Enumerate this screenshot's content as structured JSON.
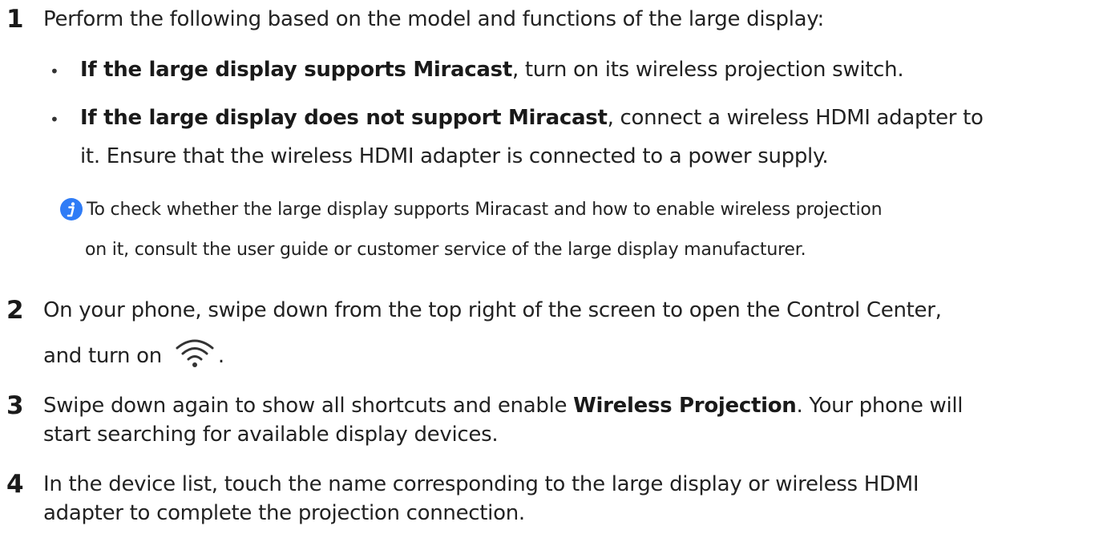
{
  "steps": [
    {
      "number": "1",
      "text": "Perform the following based on the model and functions of the large display:",
      "bullets": [
        {
          "bold": "If the large display supports Miracast",
          "rest": ", turn on its wireless projection switch."
        },
        {
          "bold": "If the large display does not support Miracast",
          "rest": ", connect a wireless HDMI adapter to",
          "continuation": "it. Ensure that the wireless HDMI adapter is connected to a power supply."
        }
      ],
      "note": {
        "icon": "info-icon",
        "line1": "To check whether the large display supports Miracast and how to enable wireless projection",
        "line2": "on it, consult the user guide or customer service of the large display manufacturer."
      }
    },
    {
      "number": "2",
      "line1": "On your phone, swipe down from the top right of the screen to open the Control Center,",
      "line2_prefix": "and turn on",
      "line2_icon": "wifi-icon",
      "line2_suffix": "."
    },
    {
      "number": "3",
      "text_before": "Swipe down again to show all shortcuts and enable ",
      "bold": "Wireless Projection",
      "text_after": ". Your phone will",
      "line2": "start searching for available display devices."
    },
    {
      "number": "4",
      "line1": "In the device list, touch the name corresponding to the large display or wireless HDMI",
      "line2": "adapter to complete the projection connection."
    }
  ],
  "colors": {
    "info_icon": "#2f7cf6",
    "text": "#222222"
  }
}
